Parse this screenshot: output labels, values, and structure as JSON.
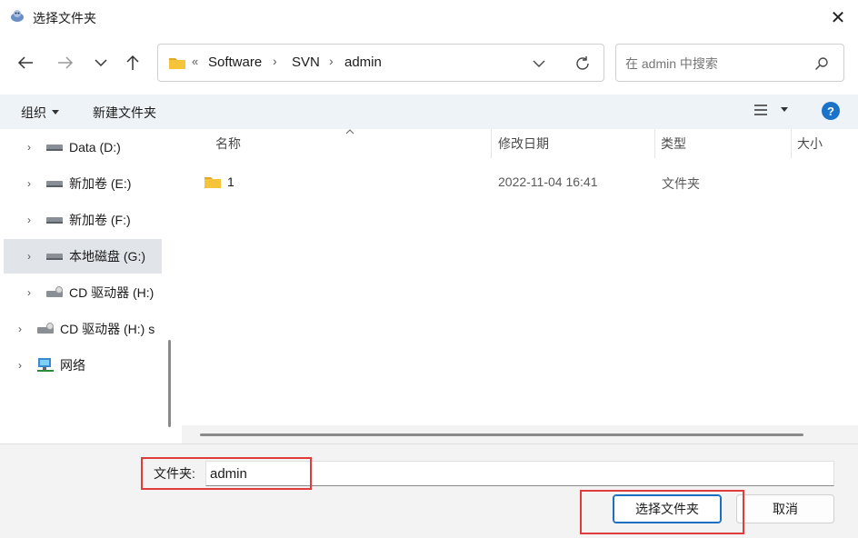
{
  "window": {
    "title": "选择文件夹",
    "close_glyph": "✕"
  },
  "nav": {
    "breadcrumb_overflow": "«",
    "breadcrumb": [
      "Software",
      "SVN",
      "admin"
    ]
  },
  "search": {
    "placeholder": "在 admin 中搜索"
  },
  "toolbar": {
    "organize_label": "组织",
    "new_folder_label": "新建文件夹",
    "help_glyph": "?"
  },
  "sidebar": {
    "items": [
      {
        "label": "Data (D:)",
        "icon": "drive-icon"
      },
      {
        "label": "新加卷 (E:)",
        "icon": "drive-icon"
      },
      {
        "label": "新加卷 (F:)",
        "icon": "drive-icon"
      },
      {
        "label": "本地磁盘 (G:)",
        "icon": "drive-icon",
        "selected": true
      },
      {
        "label": "CD 驱动器 (H:)",
        "icon": "cd-drive-icon"
      },
      {
        "label": "CD 驱动器 (H:) s",
        "icon": "cd-drive-icon"
      },
      {
        "label": "网络",
        "icon": "network-icon"
      }
    ]
  },
  "list": {
    "columns": [
      "名称",
      "修改日期",
      "类型",
      "大小"
    ],
    "rows": [
      {
        "name": "1",
        "modified": "2022-11-04 16:41",
        "type": "文件夹",
        "size": ""
      }
    ]
  },
  "bottom": {
    "folder_label": "文件夹:",
    "folder_value": "admin",
    "select_button": "选择文件夹",
    "cancel_button": "取消"
  },
  "colors": {
    "highlight": "#e03c3c",
    "toolbar_bg": "#eef3f8",
    "help_blue": "#1a73c8",
    "folder_yellow": "#f5c43a"
  }
}
